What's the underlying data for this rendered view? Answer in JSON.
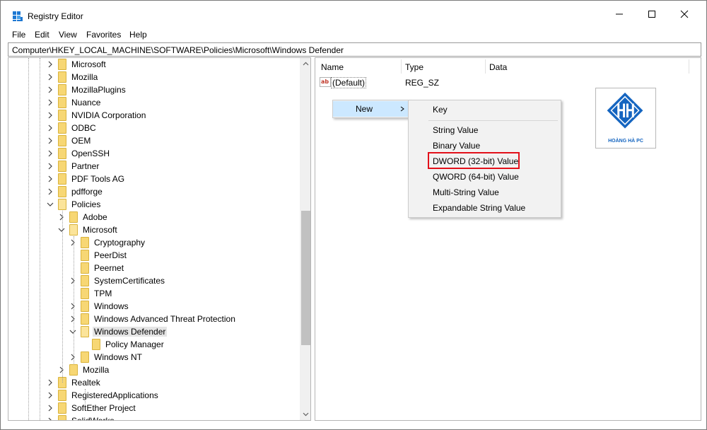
{
  "window": {
    "title": "Registry Editor"
  },
  "menu": [
    "File",
    "Edit",
    "View",
    "Favorites",
    "Help"
  ],
  "address": "Computer\\HKEY_LOCAL_MACHINE\\SOFTWARE\\Policies\\Microsoft\\Windows Defender",
  "tree": [
    {
      "label": "Microsoft",
      "expanded": false
    },
    {
      "label": "Mozilla",
      "expanded": false
    },
    {
      "label": "MozillaPlugins",
      "expanded": false
    },
    {
      "label": "Nuance",
      "expanded": false
    },
    {
      "label": "NVIDIA Corporation",
      "expanded": false
    },
    {
      "label": "ODBC",
      "expanded": false
    },
    {
      "label": "OEM",
      "expanded": false
    },
    {
      "label": "OpenSSH",
      "expanded": false
    },
    {
      "label": "Partner",
      "expanded": false
    },
    {
      "label": "PDF Tools AG",
      "expanded": false
    },
    {
      "label": "pdfforge",
      "expanded": false
    },
    {
      "label": "Policies",
      "expanded": true
    },
    {
      "label": "Adobe",
      "expanded": false
    },
    {
      "label": "Microsoft",
      "expanded": true
    },
    {
      "label": "Cryptography",
      "expanded": false
    },
    {
      "label": "PeerDist",
      "expanded": false
    },
    {
      "label": "Peernet",
      "expanded": false
    },
    {
      "label": "SystemCertificates",
      "expanded": false
    },
    {
      "label": "TPM",
      "expanded": false
    },
    {
      "label": "Windows",
      "expanded": false
    },
    {
      "label": "Windows Advanced Threat Protection",
      "expanded": false
    },
    {
      "label": "Windows Defender",
      "expanded": true,
      "selected": true
    },
    {
      "label": "Policy Manager",
      "expanded": false
    },
    {
      "label": "Windows NT",
      "expanded": false
    },
    {
      "label": "Mozilla",
      "expanded": false
    },
    {
      "label": "Realtek",
      "expanded": false
    },
    {
      "label": "RegisteredApplications",
      "expanded": false
    },
    {
      "label": "SoftEther Project",
      "expanded": false
    },
    {
      "label": "SolidWorks",
      "expanded": false
    }
  ],
  "columns": {
    "name": "Name",
    "type": "Type",
    "data": "Data"
  },
  "values": [
    {
      "icon": "ab",
      "name": "(Default)",
      "type": "REG_SZ",
      "data": ""
    }
  ],
  "context_menu": {
    "new_label": "New",
    "submenu": [
      "Key",
      "String Value",
      "Binary Value",
      "DWORD (32-bit) Value",
      "QWORD (64-bit) Value",
      "Multi-String Value",
      "Expandable String Value"
    ]
  },
  "logo": {
    "caption": "HOÀNG HÀ PC"
  },
  "colors": {
    "folder": "#f7d774",
    "menu_bg": "#f2f2f2",
    "menu_hover": "#cce8ff",
    "highlight": "#e3101a",
    "logo_blue": "#1565c0"
  }
}
